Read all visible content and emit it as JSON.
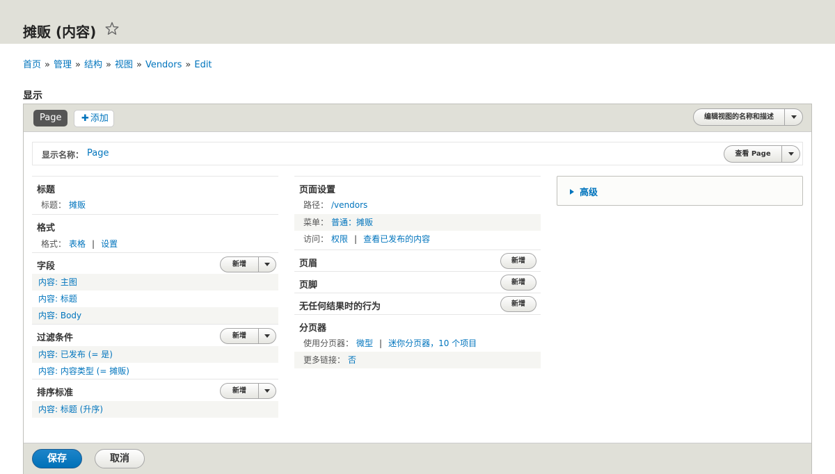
{
  "header": {
    "title": "摊贩 (内容)",
    "star_icon": "star-outline-icon"
  },
  "breadcrumb": [
    {
      "label": "首页"
    },
    {
      "label": "管理"
    },
    {
      "label": "结构"
    },
    {
      "label": "视图"
    },
    {
      "label": "Vendors"
    },
    {
      "label": "Edit"
    }
  ],
  "breadcrumb_separator": "»",
  "section_title": "显示",
  "tabs": {
    "page_tab": "Page",
    "add_label": "添加",
    "add_icon": "plus-icon"
  },
  "edit_view_name_button": "编辑视图的名称和描述",
  "display_name": {
    "label": "显示名称：",
    "value": "Page",
    "view_button": "查看 Page"
  },
  "left_column": {
    "title_section": {
      "title": "标题",
      "label": "标题：",
      "value": "摊贩"
    },
    "format_section": {
      "title": "格式",
      "label": "格式：",
      "value": "表格",
      "separator": "|",
      "settings": "设置"
    },
    "fields_section": {
      "title": "字段",
      "button": "新增",
      "items": [
        "内容: 主图",
        "内容: 标题",
        "内容: Body"
      ]
    },
    "filter_section": {
      "title": "过滤条件",
      "button": "新增",
      "items": [
        "内容: 已发布 (= 是)",
        "内容: 内容类型 (= 摊贩)"
      ]
    },
    "sort_section": {
      "title": "排序标准",
      "button": "新增",
      "items": [
        "内容: 标题 (升序)"
      ]
    }
  },
  "middle_column": {
    "page_settings": {
      "title": "页面设置",
      "path_label": "路径：",
      "path_value": "/vendors",
      "menu_label": "菜单：",
      "menu_value": "普通：摊贩",
      "access_label": "访问：",
      "access_value": "权限",
      "access_separator": "|",
      "access_detail": "查看已发布的内容"
    },
    "header_section": {
      "title": "页眉",
      "button": "新增"
    },
    "footer_section": {
      "title": "页脚",
      "button": "新增"
    },
    "no_results_section": {
      "title": "无任何结果时的行为",
      "button": "新增"
    },
    "pager_section": {
      "title": "分页器",
      "pager_label": "使用分页器：",
      "pager_value": "微型",
      "pager_separator": "|",
      "pager_detail": "迷你分页器，10 个项目",
      "more_label": "更多链接：",
      "more_value": "否"
    }
  },
  "advanced": {
    "label": "高级",
    "icon": "triangle-right-icon"
  },
  "actions": {
    "save": "保存",
    "cancel": "取消"
  },
  "colors": {
    "link": "#0074bd",
    "header_bg": "#e0e0d8",
    "primary_button": "#0071b8",
    "tab_active": "#555555"
  }
}
